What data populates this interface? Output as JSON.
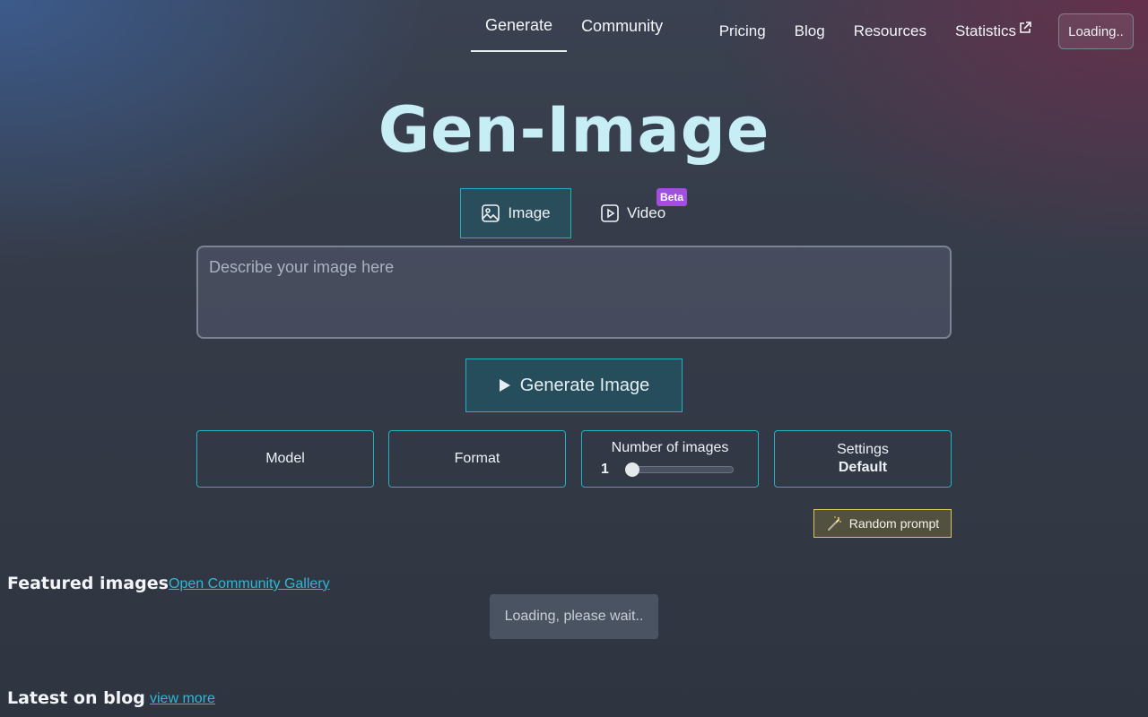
{
  "nav": {
    "left_tabs": [
      {
        "label": "Generate",
        "active": true
      },
      {
        "label": "Community",
        "active": false
      }
    ],
    "links": [
      "Pricing",
      "Blog",
      "Resources",
      "Statistics"
    ],
    "statistics_icon": "external-link-icon",
    "account_button": "Loading.."
  },
  "hero": {
    "title": "Gen-Image"
  },
  "mode_tabs": {
    "image": {
      "label": "Image",
      "icon": "image-icon",
      "active": true
    },
    "video": {
      "label": "Video",
      "icon": "play-square-icon",
      "badge": "Beta"
    }
  },
  "prompt": {
    "placeholder": "Describe your image here",
    "value": ""
  },
  "generate_button": {
    "label": "Generate Image",
    "icon": "play-icon"
  },
  "options": {
    "model": {
      "label": "Model"
    },
    "format": {
      "label": "Format"
    },
    "num_images": {
      "label": "Number of images",
      "value": "1"
    },
    "settings": {
      "label": "Settings",
      "value": "Default"
    }
  },
  "random_prompt": {
    "label": "Random prompt",
    "icon": "magic-wand-icon"
  },
  "featured": {
    "title": "Featured images",
    "link": "Open Community Gallery",
    "loading": "Loading, please wait.."
  },
  "blog": {
    "title": "Latest on blog",
    "link": "view more"
  },
  "colors": {
    "accent": "#1fb3c4",
    "title": "#c7eef5",
    "link": "#2fb8d6",
    "beta_badge": "#a24fe0",
    "random_border": "#d8c45a"
  }
}
